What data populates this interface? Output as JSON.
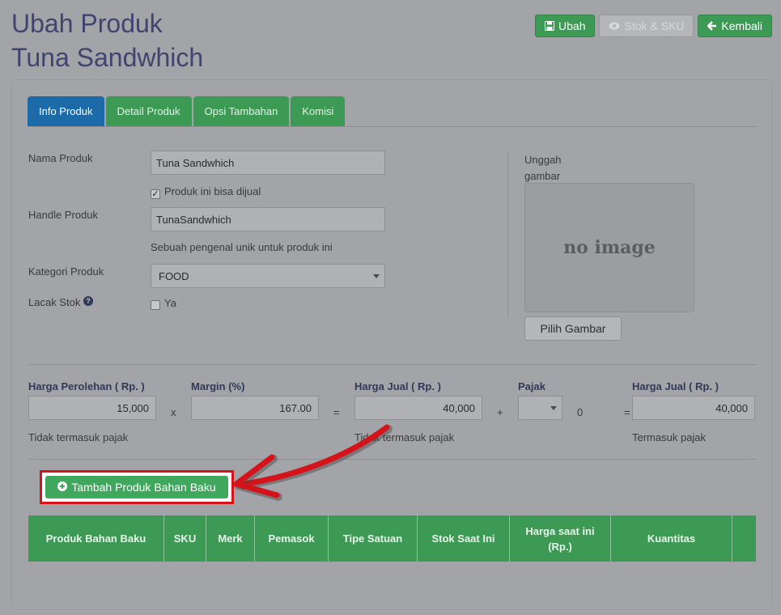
{
  "title": {
    "line1": "Ubah Produk",
    "line2": "Tuna Sandwhich"
  },
  "actions": {
    "save": "Ubah",
    "stock": "Stok & SKU",
    "back": "Kembali"
  },
  "tabs": [
    "Info Produk",
    "Detail Produk",
    "Opsi Tambahan",
    "Komisi"
  ],
  "form": {
    "name_label": "Nama Produk",
    "name_value": "Tuna Sandwhich",
    "sellable_label": "Produk ini bisa dijual",
    "sellable_checked": true,
    "handle_label": "Handle Produk",
    "handle_value": "TunaSandwhich",
    "handle_help": "Sebuah pengenal unik untuk produk ini",
    "category_label": "Kategori Produk",
    "category_value": "FOOD",
    "track_label": "Lacak Stok",
    "track_option": "Ya",
    "track_checked": false
  },
  "upload": {
    "label_line1": "Unggah",
    "label_line2": "gambar",
    "placeholder": "no image",
    "button": "Pilih Gambar"
  },
  "pricing": {
    "cost_label": "Harga Perolehan ( Rp. )",
    "cost_value": "15,000",
    "cost_note": "Tidak termasuk pajak",
    "op_x": "x",
    "margin_label": "Margin (%)",
    "margin_value": "167.00",
    "op_eq1": "=",
    "sell_label": "Harga Jual ( Rp. )",
    "sell_value": "40,000",
    "sell_note": "Tidak termasuk pajak",
    "op_plus": "+",
    "tax_label": "Pajak",
    "tax_amount": "0",
    "op_eq2": "=",
    "final_label": "Harga Jual ( Rp. )",
    "final_value": "40,000",
    "final_note": "Termasuk pajak"
  },
  "add_material_button": "Tambah Produk Bahan Baku",
  "table_headers": [
    "Produk Bahan Baku",
    "SKU",
    "Merk",
    "Pemasok",
    "Tipe Satuan",
    "Stok Saat Ini",
    "Harga saat ini (Rp.)",
    "Kuantitas",
    ""
  ],
  "colors": {
    "green": "#3c9a55",
    "blue": "#1d6aa9",
    "highlight": "#d4141a"
  },
  "icons": {
    "save": "floppy-icon",
    "stock": "eye-icon",
    "back": "arrow-left-icon",
    "help": "question-circle-icon",
    "add": "plus-circle-icon"
  }
}
